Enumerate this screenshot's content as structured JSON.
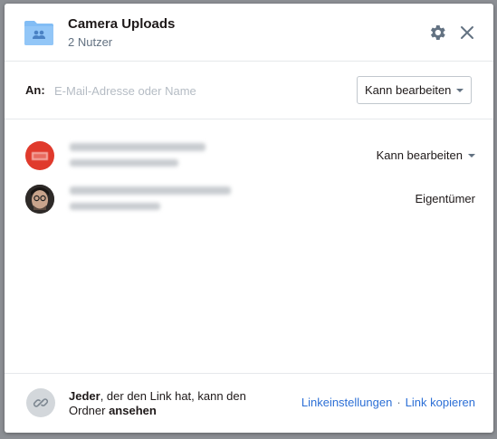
{
  "header": {
    "title": "Camera Uploads",
    "subtitle": "2 Nutzer"
  },
  "invite": {
    "to_label": "An:",
    "placeholder": "E-Mail-Adresse oder Name",
    "permission": "Kann bearbeiten"
  },
  "members": [
    {
      "permission": "Kann bearbeiten"
    },
    {
      "permission": "Eigentümer"
    }
  ],
  "footer": {
    "text_bold_1": "Jeder",
    "text_middle": ", der den Link hat, kann den Ordner ",
    "text_bold_2": "ansehen",
    "link_settings": "Linkeinstellungen",
    "separator": "·",
    "link_copy": "Link kopieren"
  },
  "colors": {
    "folder": "#82bdf5",
    "link": "#2c6fd6",
    "avatar_red": "#e03a2c"
  }
}
